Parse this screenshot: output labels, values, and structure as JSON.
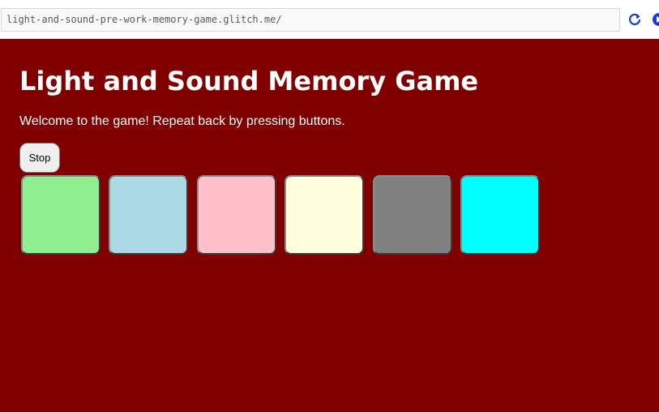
{
  "browser": {
    "url": "light-and-sound-pre-work-memory-game.glitch.me/",
    "reload_icon": "reload-icon",
    "extension_icon": "extension-icon"
  },
  "page": {
    "background_color": "#800000",
    "title": "Light and Sound Memory Game",
    "subtitle": "Welcome to the game! Repeat back by pressing buttons.",
    "stop_label": "Stop"
  },
  "game_buttons": [
    {
      "color": "#90ee90"
    },
    {
      "color": "#add8e6"
    },
    {
      "color": "#ffc0cb"
    },
    {
      "color": "#ffffe0"
    },
    {
      "color": "#808080"
    },
    {
      "color": "#00ffff"
    }
  ]
}
